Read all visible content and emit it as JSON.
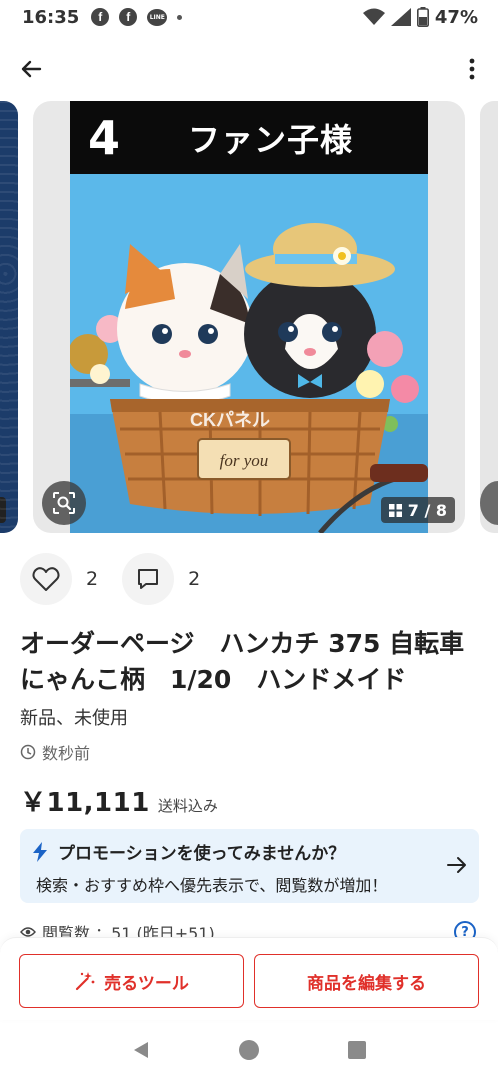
{
  "status_bar": {
    "time": "16:35",
    "notif_icons": [
      "facebook-icon",
      "facebook-icon",
      "line-icon"
    ],
    "line_label": "LINE",
    "fb_letter": "f",
    "battery": "47%"
  },
  "header": {
    "back_icon": "arrow-left-icon",
    "menu_icon": "more-vertical-icon"
  },
  "gallery": {
    "banner_number": "4",
    "banner_title": "ファン子様",
    "watermark": "CKパネル",
    "sign_text": "for you",
    "counter": "7 / 8",
    "lens_icon": "image-search-icon"
  },
  "actions": {
    "likes": "2",
    "comments": "2"
  },
  "item": {
    "title": "オーダーページ　ハンカチ 375 自転車にゃんこ柄　1/20　ハンドメイド",
    "condition": "新品、未使用",
    "posted": "数秒前",
    "price": "￥11,111",
    "shipping": "送料込み"
  },
  "promo": {
    "title": "プロモーションを使ってみませんか？",
    "body": "検索・おすすめ枠へ優先表示で、閲覧数が増加！"
  },
  "views": {
    "text": "閲覧数 ：51 (昨日+51)"
  },
  "bottom_actions": {
    "sell_tools": "売るツール",
    "edit_item": "商品を編集する"
  },
  "colors": {
    "accent_red": "#e0302a",
    "promo_bg": "#e9f3fc",
    "link_blue": "#1b63c6"
  }
}
